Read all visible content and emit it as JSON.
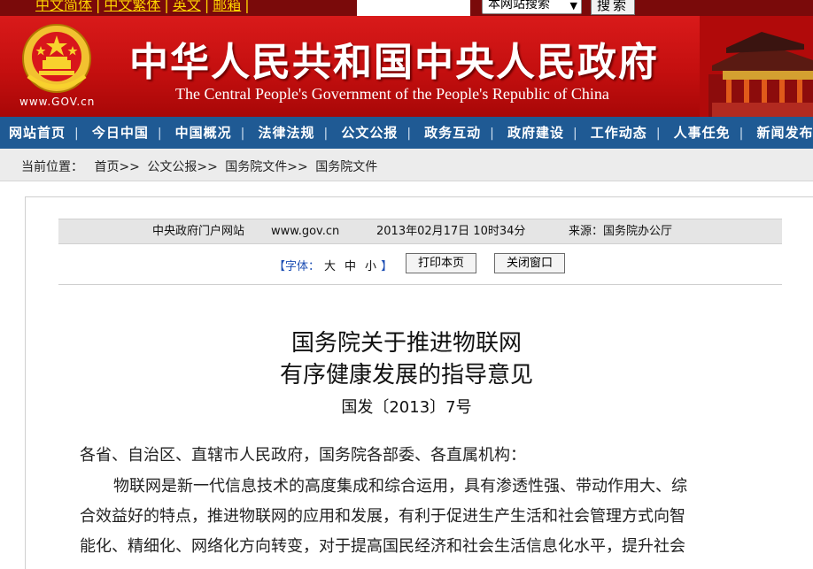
{
  "topbar": {
    "lang_links": [
      "中文简体",
      "中文繁体",
      "英文",
      "邮箱"
    ],
    "search_placeholder": "",
    "search_scope": "本网站搜索",
    "search_button": "搜索"
  },
  "banner": {
    "url": "www.GOV.cn",
    "title": "中华人民共和国中央人民政府",
    "subtitle": "The Central People's Government of the People's Republic of China"
  },
  "nav": {
    "items": [
      "网站首页",
      "今日中国",
      "中国概况",
      "法律法规",
      "公文公报",
      "政务互动",
      "政府建设",
      "工作动态",
      "人事任免",
      "新闻发布"
    ]
  },
  "breadcrumb": {
    "label": "当前位置：",
    "items": [
      "首页>>",
      "公文公报>>",
      "国务院文件>>",
      "国务院文件"
    ]
  },
  "meta": {
    "site": "中央政府门户网站",
    "domain": "www.gov.cn",
    "date": "2013年02月17日 10时34分",
    "source": "来源：国务院办公厅"
  },
  "tools": {
    "font_label": "【字体：",
    "sizes": [
      "大",
      "中",
      "小"
    ],
    "font_close": "】",
    "print": "打印本页",
    "close": "关闭窗口"
  },
  "document": {
    "title_line1": "国务院关于推进物联网",
    "title_line2": "有序健康发展的指导意见",
    "number": "国发〔2013〕7号",
    "salutation": "各省、自治区、直辖市人民政府，国务院各部委、各直属机构：",
    "para1_line1": "物联网是新一代信息技术的高度集成和综合运用，具有渗透性强、带动作用大、综",
    "para1_line2": "合效益好的特点，推进物联网的应用和发展，有利于促进生产生活和社会管理方式向智",
    "para1_line3": "能化、精细化、网络化方向转变，对于提高国民经济和社会生活信息化水平，提升社会"
  },
  "colors": {
    "topbar": "#7a0a0a",
    "banner_red": "#c40f0f",
    "nav_blue": "#1f5a94",
    "link_yellow": "#ffd400",
    "font_link_blue": "#1b4db3"
  }
}
